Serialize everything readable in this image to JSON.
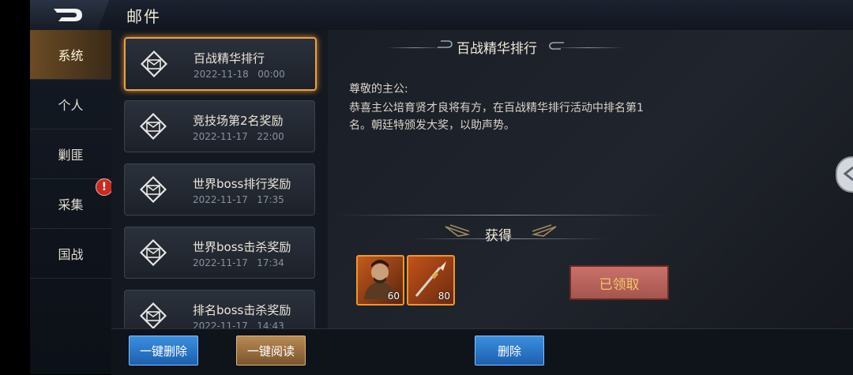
{
  "header": {
    "title": "邮件"
  },
  "sidebar": {
    "tabs": [
      {
        "label": "系统",
        "active": true
      },
      {
        "label": "个人"
      },
      {
        "label": "剿匪"
      },
      {
        "label": "采集",
        "badge": "!"
      },
      {
        "label": "国战"
      }
    ]
  },
  "mails": [
    {
      "title": "百战精华排行",
      "date": "2022-11-18",
      "time": "00:00",
      "selected": true
    },
    {
      "title": "竞技场第2名奖励",
      "date": "2022-11-17",
      "time": "22:00"
    },
    {
      "title": "世界boss排行奖励",
      "date": "2022-11-17",
      "time": "17:35"
    },
    {
      "title": "世界boss击杀奖励",
      "date": "2022-11-17",
      "time": "17:34"
    },
    {
      "title": "排名boss击杀奖励",
      "date": "2022-11-17",
      "time": "14:43"
    }
  ],
  "detail": {
    "heading": "百战精华排行",
    "greeting": "尊敬的主公:",
    "body": "恭喜主公培育贤才良将有方，在百战精华排行活动中排名第1名。朝廷特颁发大奖，以助声势。",
    "reward_label": "获得",
    "rewards": [
      {
        "icon": "hero-portrait-icon",
        "qty": "60"
      },
      {
        "icon": "spear-icon",
        "qty": "80"
      }
    ],
    "claim_status": "已领取"
  },
  "footer": {
    "delete_all": "一键删除",
    "read_all": "一键阅读",
    "delete": "删除"
  },
  "colors": {
    "accent": "#e7a24a",
    "button_blue": "#2f7fd0",
    "badge_red": "#c92a1f"
  }
}
